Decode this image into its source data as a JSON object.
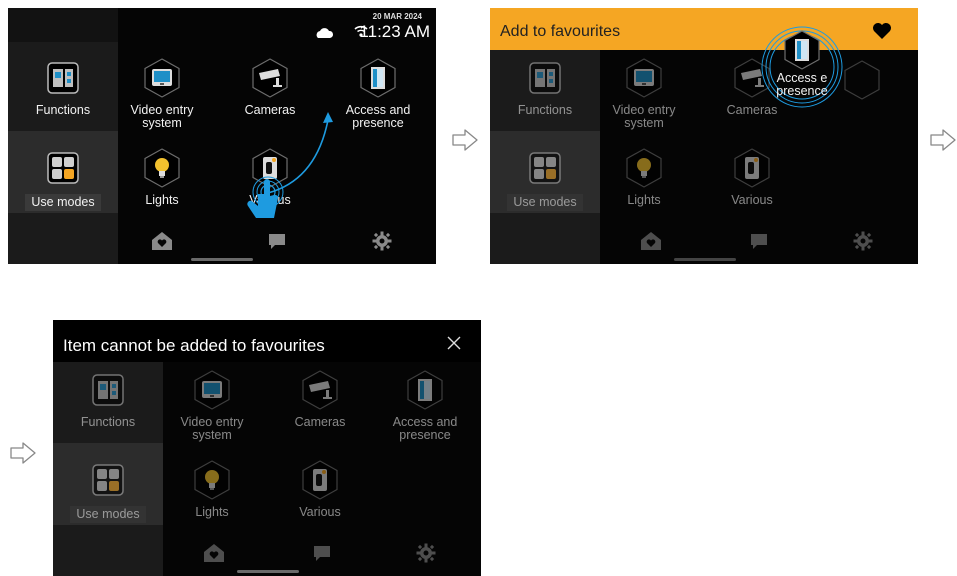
{
  "screens": {
    "first": {
      "status": {
        "date": "20 MAR 2024",
        "time": "11:23 AM"
      },
      "tiles": {
        "functions": "Functions",
        "video": "Video entry system",
        "cameras": "Cameras",
        "access": "Access and presence",
        "use_modes": "Use modes",
        "lights": "Lights",
        "various": "Various"
      }
    },
    "second": {
      "header_title": "Add to favourites",
      "tiles": {
        "functions": "Functions",
        "video": "Video entry system",
        "cameras": "Cameras",
        "access": "Access e presence",
        "use_modes": "Use modes",
        "lights": "Lights",
        "various": "Various"
      }
    },
    "third": {
      "header_title": "Item cannot be added to favourites",
      "tiles": {
        "functions": "Functions",
        "video": "Video entry system",
        "cameras": "Cameras",
        "access": "Access and presence",
        "use_modes": "Use modes",
        "lights": "Lights",
        "various": "Various"
      }
    }
  },
  "icons": [
    "cloud-icon",
    "wifi-icon",
    "heart-icon",
    "close-icon",
    "home-heart-icon",
    "chat-icon",
    "gear-icon",
    "touch-hand-icon",
    "next-arrow-icon"
  ],
  "colors": {
    "accent_orange": "#f5a623",
    "access_blue": "#1e8fc7",
    "light_yellow": "#f2c12e",
    "sidebar": "#1b1b1b"
  }
}
